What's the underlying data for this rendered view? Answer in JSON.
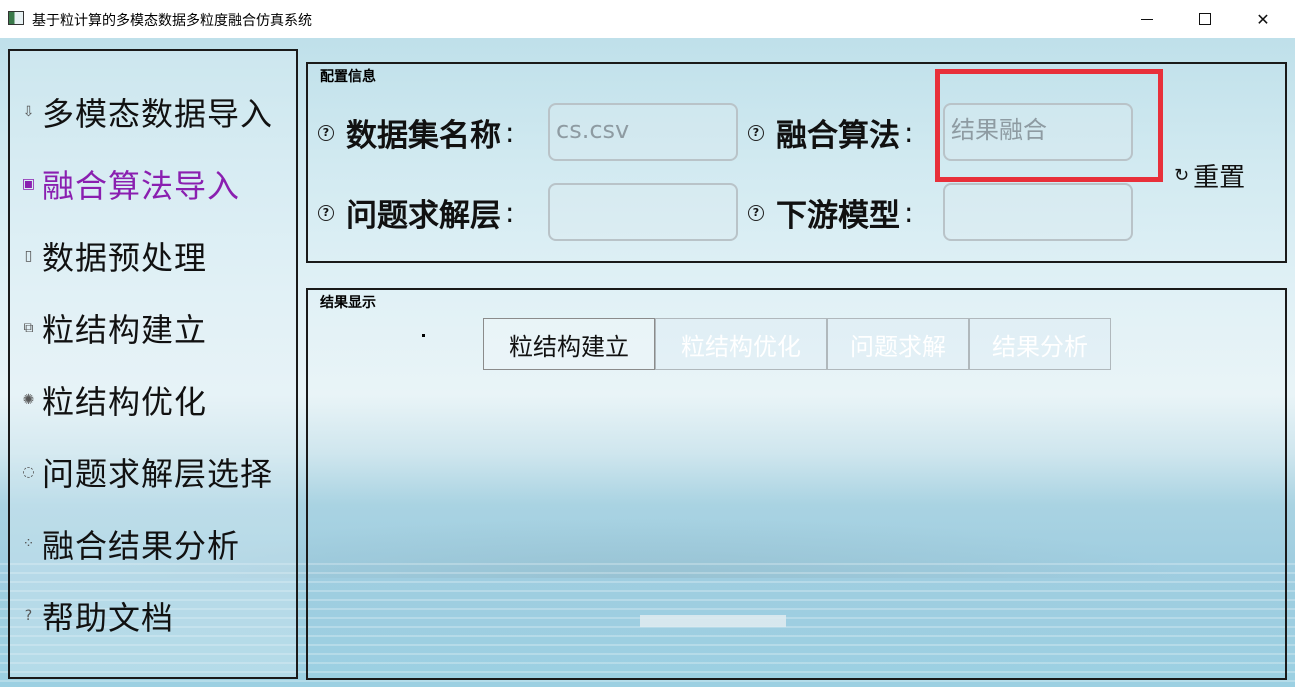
{
  "window": {
    "title": "基于粒计算的多模态数据多粒度融合仿真系统"
  },
  "sidebar": {
    "items": [
      {
        "label": "多模态数据导入",
        "icon": "download-icon"
      },
      {
        "label": "融合算法导入",
        "icon": "inbox-download-icon",
        "active": true
      },
      {
        "label": "数据预处理",
        "icon": "file-gear-icon"
      },
      {
        "label": "粒结构建立",
        "icon": "copy-plus-icon"
      },
      {
        "label": "粒结构优化",
        "icon": "atom-icon"
      },
      {
        "label": "问题求解层选择",
        "icon": "lightbulb-icon"
      },
      {
        "label": "融合结果分析",
        "icon": "spinner-dots-icon"
      },
      {
        "label": "帮助文档",
        "icon": "help-circle-icon"
      }
    ]
  },
  "config": {
    "group_title": "配置信息",
    "dataset_label": "数据集名称",
    "dataset_value": "cs.csv",
    "algorithm_label": "融合算法",
    "algorithm_value": "结果融合",
    "solve_layer_label": "问题求解层",
    "solve_layer_value": "",
    "downstream_label": "下游模型",
    "downstream_value": "",
    "colon": ":",
    "reset_label": "重置"
  },
  "result": {
    "group_title": "结果显示",
    "tabs": [
      {
        "label": "粒结构建立",
        "active": true
      },
      {
        "label": "粒结构优化",
        "active": false
      },
      {
        "label": "问题求解",
        "active": false
      },
      {
        "label": "结果分析",
        "active": false
      }
    ]
  },
  "colors": {
    "active_nav": "#8a1fb0",
    "highlight_border": "#e8303a"
  }
}
